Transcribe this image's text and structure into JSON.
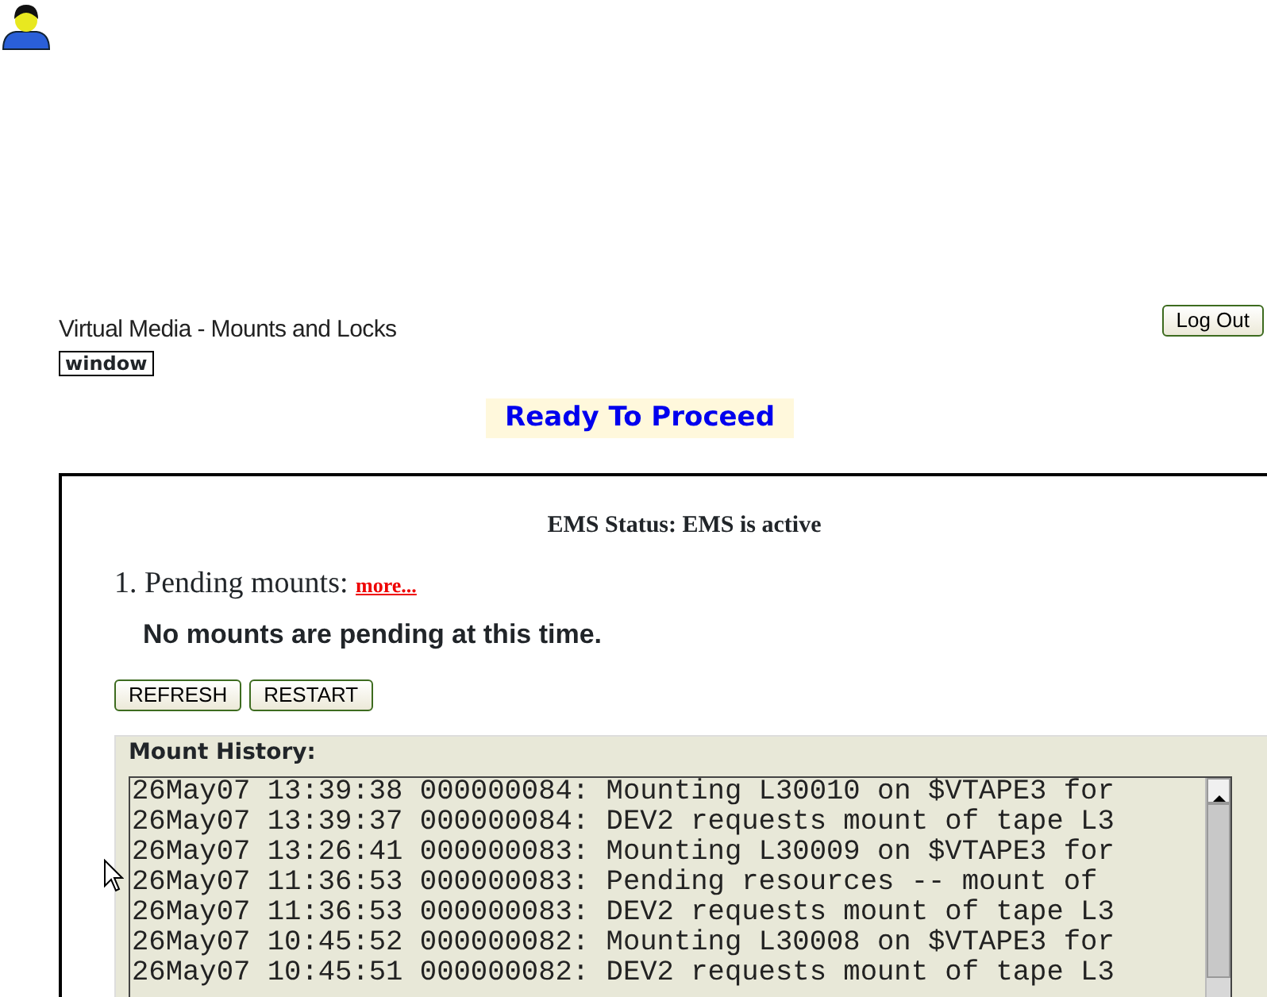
{
  "header": {
    "title": "Virtual Media - Mounts and Locks",
    "window_label": "window",
    "logout_button": "Log Out"
  },
  "status_banner": "Ready To Proceed",
  "panel": {
    "ems_status": "EMS Status: EMS is active",
    "section_number": "1.",
    "section_title": "Pending mounts:",
    "more_link": "more...",
    "message": "No mounts are pending at this time.",
    "buttons": [
      "REFRESH",
      "RESTART"
    ],
    "history": {
      "label": "Mount History:",
      "lines": [
        "26May07 13:39:38 000000084: Mounting L30010 on $VTAPE3 for",
        "26May07 13:39:37 000000084: DEV2 requests mount of tape L3",
        "26May07 13:26:41 000000083: Mounting L30009 on $VTAPE3 for",
        "26May07 11:36:53 000000083: Pending resources -- mount of",
        "26May07 11:36:53 000000083: DEV2 requests mount of tape L3",
        "26May07 10:45:52 000000082: Mounting L30008 on $VTAPE3 for",
        "26May07 10:45:51 000000082: DEV2 requests mount of tape L3"
      ]
    }
  }
}
